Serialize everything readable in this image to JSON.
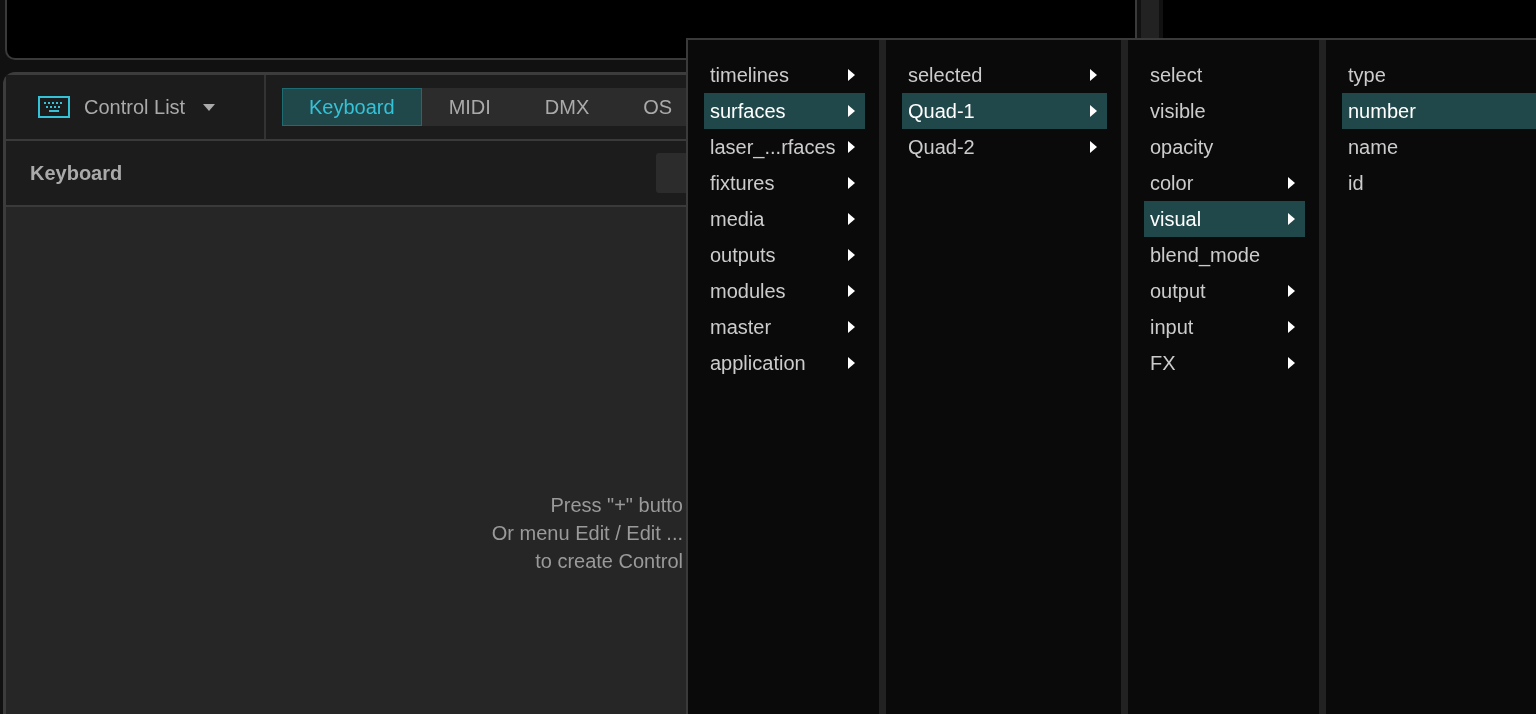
{
  "control_panel": {
    "title": "Control List",
    "tabs": [
      {
        "label": "Keyboard",
        "selected": true
      },
      {
        "label": "MIDI",
        "selected": false
      },
      {
        "label": "DMX",
        "selected": false
      },
      {
        "label": "OS",
        "selected": false
      }
    ],
    "section_title": "Keyboard",
    "empty_hint": [
      "Press \"+\" butto",
      "Or menu Edit / Edit ...",
      "to create Control"
    ]
  },
  "menu": {
    "columns": [
      {
        "items": [
          {
            "label": "timelines",
            "selected": false,
            "submenu": true
          },
          {
            "label": "surfaces",
            "selected": true,
            "submenu": true
          },
          {
            "label": "laser_...rfaces",
            "selected": false,
            "submenu": true
          },
          {
            "label": "fixtures",
            "selected": false,
            "submenu": true
          },
          {
            "label": "media",
            "selected": false,
            "submenu": true
          },
          {
            "label": "outputs",
            "selected": false,
            "submenu": true
          },
          {
            "label": "modules",
            "selected": false,
            "submenu": true
          },
          {
            "label": "master",
            "selected": false,
            "submenu": true
          },
          {
            "label": "application",
            "selected": false,
            "submenu": true
          }
        ]
      },
      {
        "items": [
          {
            "label": "selected",
            "selected": false,
            "submenu": true
          },
          {
            "label": "Quad-1",
            "selected": true,
            "submenu": true
          },
          {
            "label": "Quad-2",
            "selected": false,
            "submenu": true
          }
        ]
      },
      {
        "items": [
          {
            "label": "select",
            "selected": false,
            "submenu": false
          },
          {
            "label": "visible",
            "selected": false,
            "submenu": false
          },
          {
            "label": "opacity",
            "selected": false,
            "submenu": false
          },
          {
            "label": "color",
            "selected": false,
            "submenu": true
          },
          {
            "label": "visual",
            "selected": true,
            "submenu": true
          },
          {
            "label": "blend_mode",
            "selected": false,
            "submenu": false
          },
          {
            "label": "output",
            "selected": false,
            "submenu": true
          },
          {
            "label": "input",
            "selected": false,
            "submenu": true
          },
          {
            "label": "FX",
            "selected": false,
            "submenu": true
          }
        ]
      },
      {
        "items": [
          {
            "label": "type",
            "selected": false,
            "submenu": false
          },
          {
            "label": "number",
            "selected": true,
            "submenu": false
          },
          {
            "label": "name",
            "selected": false,
            "submenu": false
          },
          {
            "label": "id",
            "selected": false,
            "submenu": false
          }
        ]
      }
    ]
  }
}
